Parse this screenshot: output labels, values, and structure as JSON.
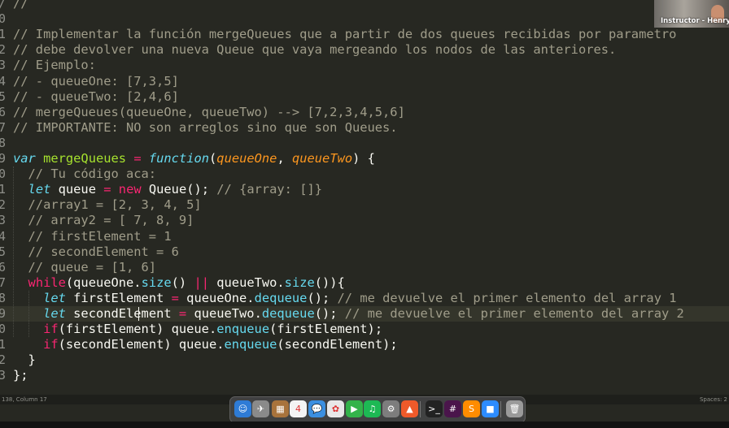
{
  "editor": {
    "gutter": [
      "/",
      "0",
      "1",
      "2",
      "3",
      "4",
      "5",
      "6",
      "7",
      "8",
      "9",
      "0",
      "1",
      "2",
      "3",
      "4",
      "5",
      "6",
      "7",
      "8",
      "9",
      "0",
      "1",
      "2",
      "3"
    ],
    "code_lines": [
      [
        {
          "t": "//",
          "c": "comment"
        }
      ],
      [],
      [
        {
          "t": "// Implementar la función mergeQueues que a partir de dos queues recibidas por parametro",
          "c": "comment"
        }
      ],
      [
        {
          "t": "// debe devolver una nueva Queue que vaya mergeando los nodos de las anteriores.",
          "c": "comment"
        }
      ],
      [
        {
          "t": "// Ejemplo:",
          "c": "comment"
        }
      ],
      [
        {
          "t": "// - queueOne: [7,3,5]",
          "c": "comment"
        }
      ],
      [
        {
          "t": "// - queueTwo: [2,4,6]",
          "c": "comment"
        }
      ],
      [
        {
          "t": "// mergeQueues(queueOne, queueTwo) --> [7,2,3,4,5,6]",
          "c": "comment"
        }
      ],
      [
        {
          "t": "// IMPORTANTE: NO son arreglos sino que son Queues.",
          "c": "comment"
        }
      ],
      [],
      [
        {
          "t": "var",
          "c": "keyword"
        },
        {
          "t": " ",
          "c": "plain"
        },
        {
          "t": "mergeQueues",
          "c": "fn"
        },
        {
          "t": " ",
          "c": "plain"
        },
        {
          "t": "=",
          "c": "op"
        },
        {
          "t": " ",
          "c": "plain"
        },
        {
          "t": "function",
          "c": "keyword"
        },
        {
          "t": "(",
          "c": "plain"
        },
        {
          "t": "queueOne",
          "c": "param"
        },
        {
          "t": ", ",
          "c": "plain"
        },
        {
          "t": "queueTwo",
          "c": "param"
        },
        {
          "t": ") {",
          "c": "plain"
        }
      ],
      [
        {
          "t": "  // Tu código aca:",
          "c": "comment"
        }
      ],
      [
        {
          "t": "  ",
          "c": "plain"
        },
        {
          "t": "let",
          "c": "keyword"
        },
        {
          "t": " queue ",
          "c": "plain"
        },
        {
          "t": "=",
          "c": "op"
        },
        {
          "t": " ",
          "c": "plain"
        },
        {
          "t": "new",
          "c": "op"
        },
        {
          "t": " Queue(); ",
          "c": "plain"
        },
        {
          "t": "// {array: []}",
          "c": "comment"
        }
      ],
      [
        {
          "t": "  //array1 = [2, 3, 4, 5]",
          "c": "comment"
        }
      ],
      [
        {
          "t": "  // array2 = [ 7, 8, 9]",
          "c": "comment"
        }
      ],
      [
        {
          "t": "  // firstElement = 1",
          "c": "comment"
        }
      ],
      [
        {
          "t": "  // secondElement = 6",
          "c": "comment"
        }
      ],
      [
        {
          "t": "  // queue = [1, 6]",
          "c": "comment"
        }
      ],
      [
        {
          "t": "  ",
          "c": "plain"
        },
        {
          "t": "while",
          "c": "op"
        },
        {
          "t": "(queueOne.",
          "c": "plain"
        },
        {
          "t": "size",
          "c": "method"
        },
        {
          "t": "() ",
          "c": "plain"
        },
        {
          "t": "||",
          "c": "op"
        },
        {
          "t": " queueTwo.",
          "c": "plain"
        },
        {
          "t": "size",
          "c": "method"
        },
        {
          "t": "()){",
          "c": "plain"
        }
      ],
      [
        {
          "t": "    ",
          "c": "plain"
        },
        {
          "t": "let",
          "c": "keyword"
        },
        {
          "t": " firstElement ",
          "c": "plain"
        },
        {
          "t": "=",
          "c": "op"
        },
        {
          "t": " queueOne.",
          "c": "plain"
        },
        {
          "t": "dequeue",
          "c": "method"
        },
        {
          "t": "(); ",
          "c": "plain"
        },
        {
          "t": "// me devuelve el primer elemento del array 1",
          "c": "comment"
        }
      ],
      [
        {
          "t": "    ",
          "c": "plain"
        },
        {
          "t": "let",
          "c": "keyword"
        },
        {
          "t": " secondElement ",
          "c": "plain"
        },
        {
          "t": "=",
          "c": "op"
        },
        {
          "t": " queueTwo.",
          "c": "plain"
        },
        {
          "t": "dequeue",
          "c": "method"
        },
        {
          "t": "(); ",
          "c": "plain"
        },
        {
          "t": "// me devuelve el primer elemento del array 2",
          "c": "comment"
        }
      ],
      [
        {
          "t": "    ",
          "c": "plain"
        },
        {
          "t": "if",
          "c": "op"
        },
        {
          "t": "(firstElement) queue.",
          "c": "plain"
        },
        {
          "t": "enqueue",
          "c": "method"
        },
        {
          "t": "(firstElement);",
          "c": "plain"
        }
      ],
      [
        {
          "t": "    ",
          "c": "plain"
        },
        {
          "t": "if",
          "c": "op"
        },
        {
          "t": "(secondElement) queue.",
          "c": "plain"
        },
        {
          "t": "enqueue",
          "c": "method"
        },
        {
          "t": "(secondElement);",
          "c": "plain"
        }
      ],
      [
        {
          "t": "  }",
          "c": "plain"
        }
      ],
      [
        {
          "t": "};",
          "c": "plain"
        }
      ]
    ],
    "colors": {
      "background": "#272822",
      "comment": "#a09d8a",
      "keyword": "#66d9ef",
      "op": "#f92672",
      "fn": "#a6e22e",
      "param": "#fd971f",
      "method": "#66d9ef"
    }
  },
  "webcam": {
    "label": "Instructor - Henry"
  },
  "status_bar": {
    "left": "138, Column 17",
    "right": "Spaces: 2"
  },
  "dock": {
    "apps": [
      {
        "name": "finder-icon",
        "glyph": "☺",
        "color": "#2e7bd6"
      },
      {
        "name": "launchpad-icon",
        "glyph": "✈",
        "color": "#8a8a8a"
      },
      {
        "name": "notes-app-icon",
        "glyph": "▦",
        "color": "#a8733c"
      },
      {
        "name": "calendar-icon",
        "glyph": "4",
        "color": "#f4f4f4"
      },
      {
        "name": "messages-icon",
        "glyph": "💬",
        "color": "#3b8fe0"
      },
      {
        "name": "photos-icon",
        "glyph": "✿",
        "color": "#e8e8e8"
      },
      {
        "name": "facetime-icon",
        "glyph": "▶",
        "color": "#33b34a"
      },
      {
        "name": "spotify-icon",
        "glyph": "♫",
        "color": "#1db954"
      },
      {
        "name": "system-preferences-icon",
        "glyph": "⚙",
        "color": "#7d7d7d"
      },
      {
        "name": "brave-icon",
        "glyph": "▲",
        "color": "#ef5a2a"
      },
      {
        "name": "terminal-icon",
        "glyph": ">_",
        "color": "#222222"
      },
      {
        "name": "slack-icon",
        "glyph": "#",
        "color": "#4a154b"
      },
      {
        "name": "sublime-text-icon",
        "glyph": "S",
        "color": "#ff8c00"
      },
      {
        "name": "zoom-icon",
        "glyph": "■",
        "color": "#2d8cff"
      },
      {
        "name": "trash-icon",
        "glyph": "🗑",
        "color": "#9a9a9a"
      }
    ]
  }
}
